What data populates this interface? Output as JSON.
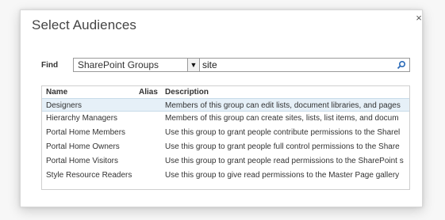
{
  "dialog": {
    "title": "Select Audiences",
    "close_label": "×"
  },
  "find": {
    "label": "Find",
    "group_select_value": "SharePoint Groups",
    "search_value": "site"
  },
  "table": {
    "headers": {
      "name": "Name",
      "alias": "Alias",
      "description": "Description"
    },
    "rows": [
      {
        "name": "Designers",
        "alias": "",
        "description": "Members of this group can edit lists, document libraries, and pages"
      },
      {
        "name": "Hierarchy Managers",
        "alias": "",
        "description": "Members of this group can create sites, lists, list items, and docum"
      },
      {
        "name": "Portal Home Members",
        "alias": "",
        "description": "Use this group to grant people contribute permissions to the Sharel"
      },
      {
        "name": "Portal Home Owners",
        "alias": "",
        "description": "Use this group to grant people full control permissions to the Share"
      },
      {
        "name": "Portal Home Visitors",
        "alias": "",
        "description": "Use this group to grant people read permissions to the SharePoint s"
      },
      {
        "name": "Style Resource Readers",
        "alias": "",
        "description": "Use this group to give read permissions to the Master Page gallery"
      }
    ]
  },
  "icons": {
    "search": "search-icon",
    "dropdown": "chevron-down-icon",
    "close": "close-icon"
  }
}
